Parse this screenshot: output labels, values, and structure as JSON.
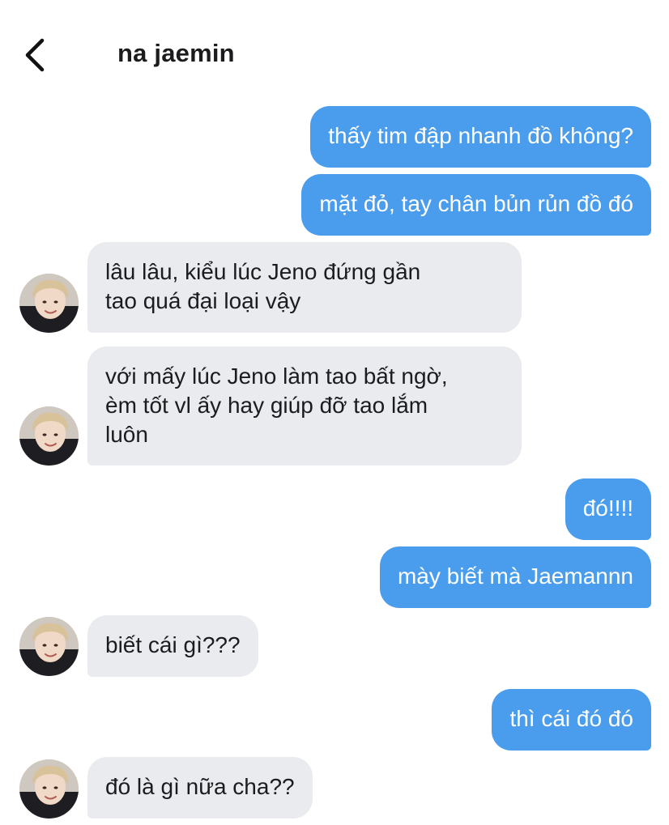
{
  "header": {
    "contact_name": "na jaemin"
  },
  "messages": [
    {
      "from": "me",
      "text": "thấy tim đập nhanh đồ không?"
    },
    {
      "from": "me",
      "text": "mặt đỏ, tay chân bủn rủn đồ đó"
    },
    {
      "from": "them",
      "lines": [
        "lâu lâu, kiểu lúc Jeno đứng gần",
        "tao quá đại loại vậy"
      ]
    },
    {
      "from": "them",
      "lines": [
        "với mấy lúc Jeno làm tao bất ngờ,",
        "èm tốt vl ấy hay giúp đỡ tao lắm",
        "luôn"
      ]
    },
    {
      "from": "me",
      "text": "đó!!!!"
    },
    {
      "from": "me",
      "text": "mày biết mà Jaemannn"
    },
    {
      "from": "them",
      "lines": [
        "biết cái gì???"
      ]
    },
    {
      "from": "me",
      "text": "thì cái đó đó"
    },
    {
      "from": "them",
      "lines": [
        "đó là gì nữa cha??"
      ]
    }
  ],
  "colors": {
    "outgoing_bubble": "#4a9cec",
    "incoming_bubble": "#e9ebee",
    "outgoing_text": "#ffffff",
    "incoming_text": "#1c1c1e"
  },
  "icons": {
    "back": "chevron-left-icon",
    "avatar": "contact-avatar"
  }
}
